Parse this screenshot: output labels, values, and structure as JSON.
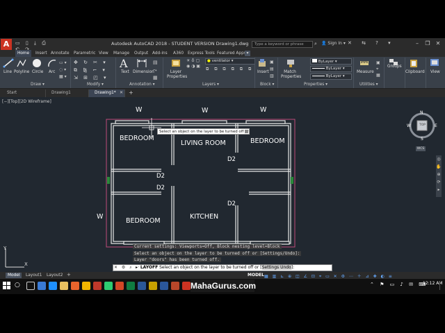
{
  "app": {
    "title": "Autodesk AutoCAD 2018 - STUDENT VERSION   Drawing1.dwg",
    "logo_letter": "A",
    "search_placeholder": "Type a keyword or phrase",
    "signin_label": "Sign In"
  },
  "menu_tabs": [
    "Home",
    "Insert",
    "Annotate",
    "Parametric",
    "View",
    "Manage",
    "Output",
    "Add-ins",
    "A360",
    "Express Tools",
    "Featured Apps"
  ],
  "ribbon": {
    "draw_tools": [
      "Line",
      "Polyline",
      "Circle",
      "Arc"
    ],
    "annotation_tools": [
      "Text",
      "Dimension"
    ],
    "layer_properties": "Layer Properties",
    "layer_current": "ventilator",
    "insert_label": "Insert",
    "match_properties": "Match Properties",
    "bylayer": [
      "ByLayer",
      "ByLayer",
      "ByLayer"
    ],
    "measure_label": "Measure",
    "groups_label": "Groups",
    "clipboard_label": "Clipboard",
    "view_label": "View",
    "groups": [
      "Draw",
      "Modify",
      "Annotation",
      "Layers",
      "Block",
      "Properties",
      "Utilities"
    ]
  },
  "file_tabs": [
    "Start",
    "Drawing1",
    "Drawing1*"
  ],
  "viewport_info": "[−][Top][2D Wireframe]",
  "viewcube": {
    "top": "TOP",
    "n": "N",
    "s": "S",
    "e": "E",
    "w": "W",
    "wcs": "WCS"
  },
  "plan": {
    "windows": [
      "W",
      "W",
      "W",
      "W"
    ],
    "rooms": [
      "BEDROOM",
      "LIVING ROOM",
      "BEDROOM",
      "BEDROOM",
      "KITCHEN"
    ],
    "doors": [
      "D2",
      "D2",
      "D2",
      "D2"
    ]
  },
  "tooltip": "Select an object on the layer to be turned off or",
  "command_history": [
    "Current settings: Viewports=Off, Block nesting level=Block",
    "Select an object on the layer to be turned off or [Settings/Undo]:",
    "Layer \"doors\" has been turned off."
  ],
  "command_prompt": {
    "cmd": "LAYOFF",
    "text": "Select an object on the layer to be turned off or [",
    "option": "Settings Undo",
    "suffix": "]:"
  },
  "layout_tabs": [
    "Model",
    "Layout1",
    "Layout2"
  ],
  "status": {
    "model": "MODEL"
  },
  "taskbar": {
    "watermark": "MahaGurus.com",
    "time": "12:12 AM"
  }
}
